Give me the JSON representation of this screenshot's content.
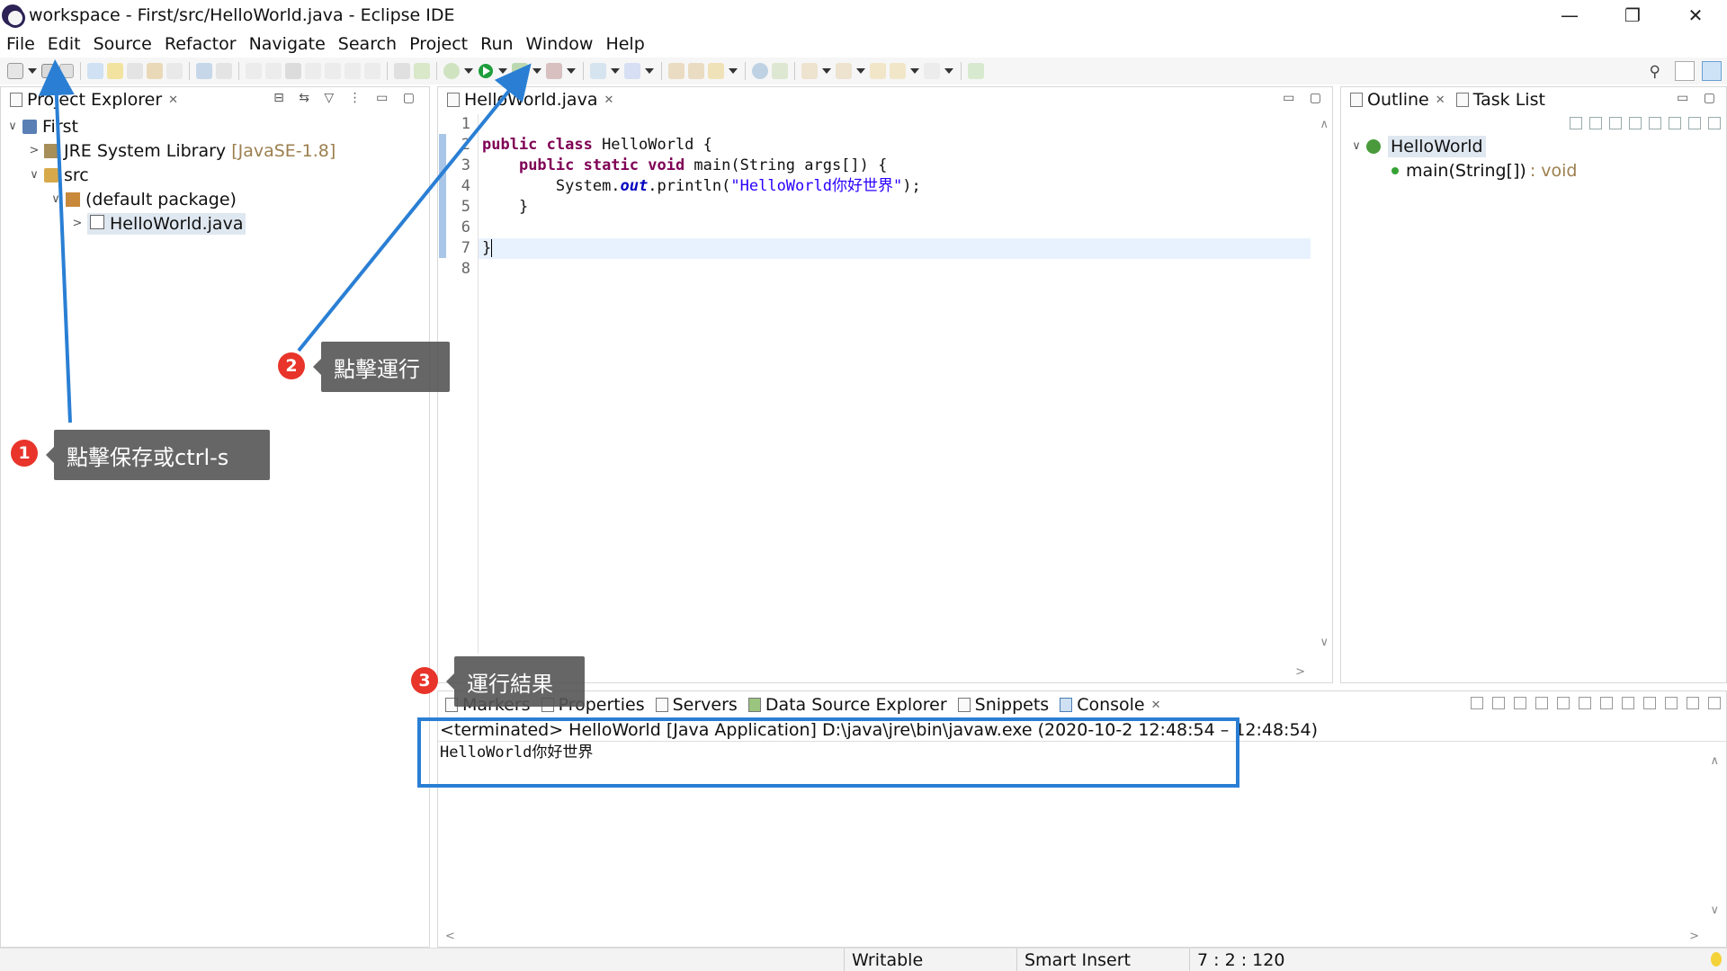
{
  "window": {
    "title": "workspace - First/src/HelloWorld.java - Eclipse IDE",
    "controls": [
      "—",
      "❐",
      "✕"
    ]
  },
  "menu": [
    "File",
    "Edit",
    "Source",
    "Refactor",
    "Navigate",
    "Search",
    "Project",
    "Run",
    "Window",
    "Help"
  ],
  "explorer": {
    "tab_label": "Project Explorer",
    "tree": {
      "project": "First",
      "jre_label": "JRE System Library",
      "jre_version": "[JavaSE-1.8]",
      "src": "src",
      "package": "(default package)",
      "file": "HelloWorld.java"
    }
  },
  "editor": {
    "tab_label": "HelloWorld.java",
    "line_numbers": [
      "1",
      "2",
      "3",
      "4",
      "5",
      "6",
      "7",
      "8"
    ],
    "code": {
      "l2_kw": "public class",
      "l2_rest": " HelloWorld {",
      "l3_kw": "public static void",
      "l3_rest": " main(String args[]) {",
      "l4_a": "System.",
      "l4_b": "out",
      "l4_c": ".println(",
      "l4_str": "\"HelloWorld你好世界\"",
      "l4_d": ");",
      "l5": "}",
      "l7": "}"
    }
  },
  "outline": {
    "tabs": [
      "Outline",
      "Task List"
    ],
    "class_name": "HelloWorld",
    "method_name": "main(String[])",
    "method_type": ": void"
  },
  "console": {
    "tabs": [
      "Markers",
      "Properties",
      "Servers",
      "Data Source Explorer",
      "Snippets",
      "Console"
    ],
    "status": "<terminated> HelloWorld [Java Application] D:\\java\\jre\\bin\\javaw.exe  (2020-10-2 12:48:54 – 12:48:54)",
    "output": "HelloWorld你好世界"
  },
  "statusbar": {
    "writable": "Writable",
    "insert_mode": "Smart Insert",
    "position": "7 : 2 : 120"
  },
  "annotations": {
    "step1_num": "1",
    "step1_text": "點擊保存或ctrl-s",
    "step2_num": "2",
    "step2_text": "點擊運行",
    "step3_num": "3",
    "step3_text": "運行結果"
  },
  "colors": {
    "arrow": "#2a7fd4",
    "badge": "#e8342a",
    "callout_bg": "#555555",
    "keyword": "#7f0055",
    "string": "#2a00ff"
  }
}
